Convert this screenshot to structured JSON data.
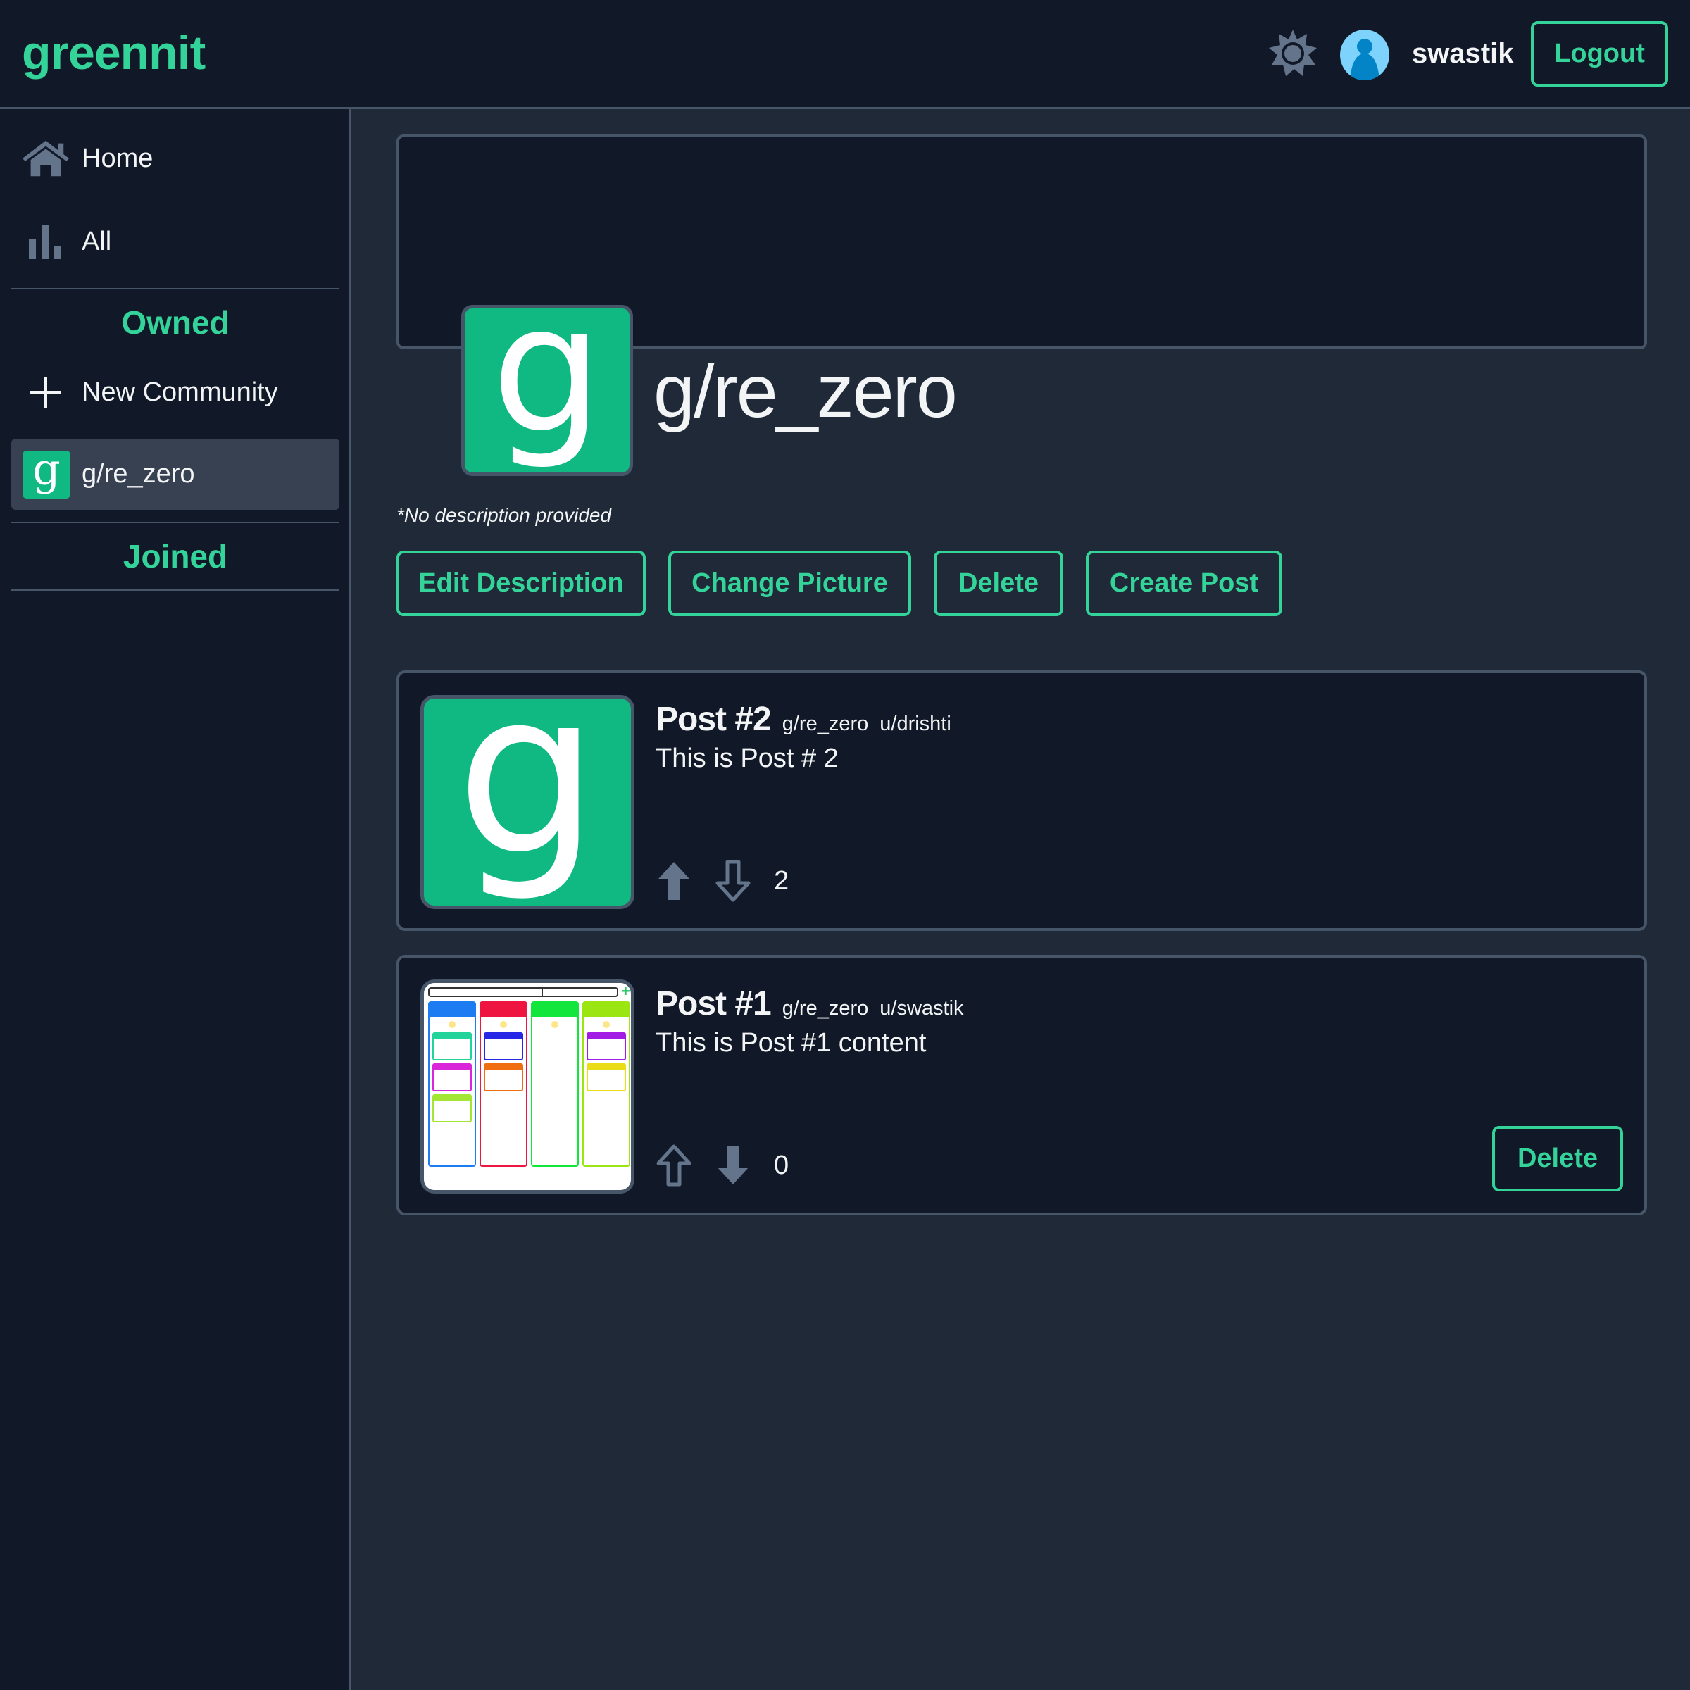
{
  "header": {
    "logo": "greennit",
    "theme_toggle_icon": "sun-icon",
    "avatar_icon": "user-avatar-icon",
    "username": "swastik",
    "logout_label": "Logout"
  },
  "sidebar": {
    "nav": [
      {
        "label": "Home",
        "icon": "home-icon"
      },
      {
        "label": "All",
        "icon": "bar-chart-icon"
      }
    ],
    "owned_title": "Owned",
    "new_community_label": "New Community",
    "owned_communities": [
      {
        "label": "g/re_zero",
        "icon_letter": "g",
        "active": true
      }
    ],
    "joined_title": "Joined"
  },
  "community": {
    "icon_letter": "g",
    "name": "g/re_zero",
    "description": "*No description provided",
    "actions": {
      "edit_description": "Edit Description",
      "change_picture": "Change Picture",
      "delete": "Delete",
      "create_post": "Create Post"
    }
  },
  "posts": [
    {
      "title": "Post #2",
      "community": "g/re_zero",
      "author": "u/drishti",
      "body": "This is Post # 2",
      "thumbnail": "community-icon",
      "thumbnail_letter": "g",
      "vote_state": "upvoted",
      "score": "2",
      "can_delete": false
    },
    {
      "title": "Post #1",
      "community": "g/re_zero",
      "author": "u/swastik",
      "body": "This is Post #1 content",
      "thumbnail": "kanban-board-screenshot",
      "vote_state": "downvoted",
      "score": "0",
      "can_delete": true,
      "delete_label": "Delete"
    }
  ],
  "colors": {
    "accent": "#34d399",
    "icon_green": "#10b981",
    "bg_dark": "#111827",
    "bg_main": "#1f2937",
    "border": "#475569",
    "icon_gray": "#64748b"
  }
}
